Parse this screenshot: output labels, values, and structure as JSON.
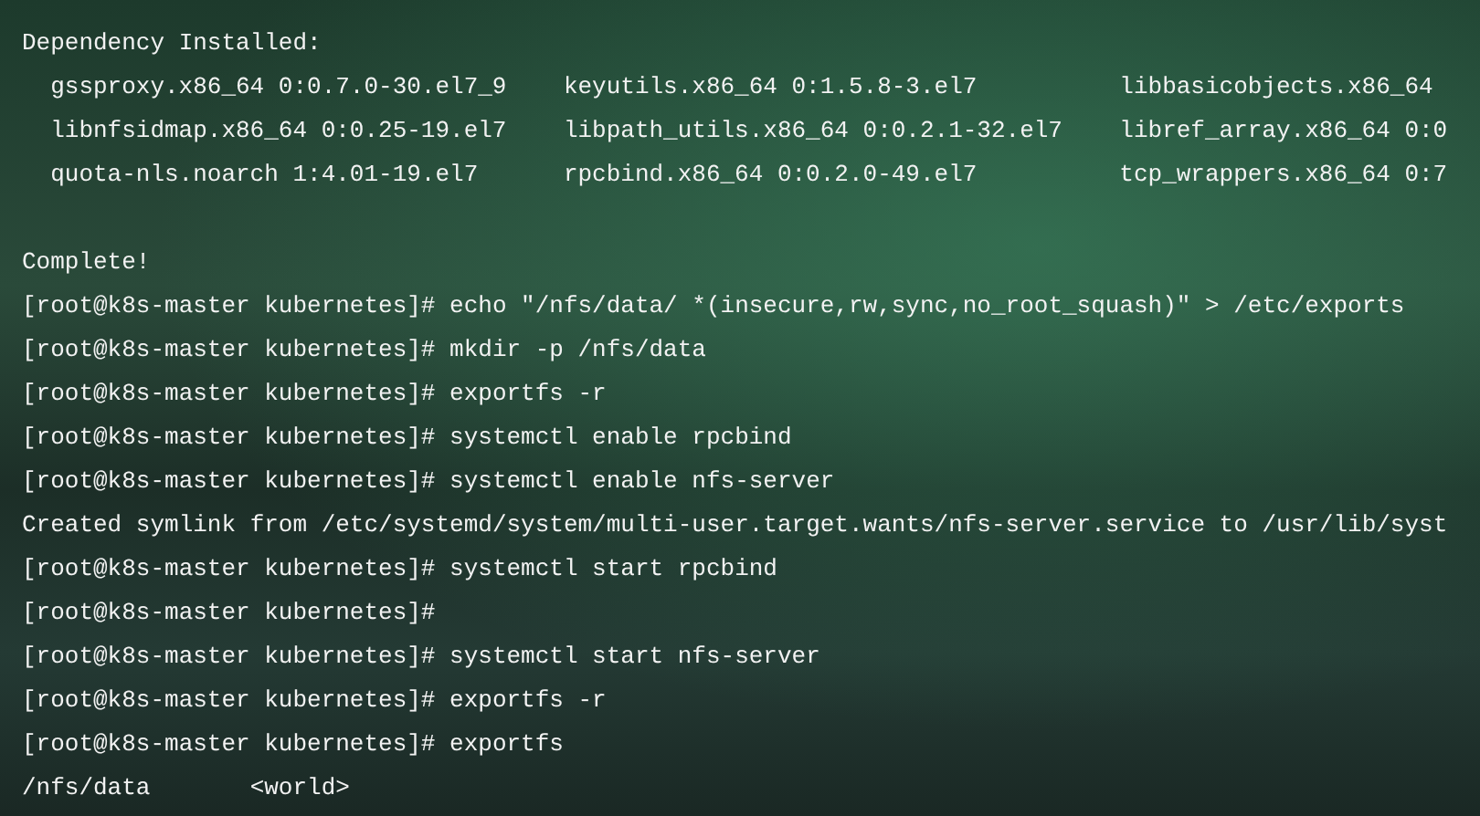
{
  "terminal": {
    "lines": [
      {
        "kind": "text",
        "text": "Dependency Installed:"
      },
      {
        "kind": "columns",
        "cells": [
          "gssproxy.x86_64 0:0.7.0-30.el7_9",
          "keyutils.x86_64 0:1.5.8-3.el7",
          "libbasicobjects.x86_64"
        ]
      },
      {
        "kind": "columns",
        "cells": [
          "libnfsidmap.x86_64 0:0.25-19.el7",
          "libpath_utils.x86_64 0:0.2.1-32.el7",
          "libref_array.x86_64 0:0"
        ]
      },
      {
        "kind": "columns",
        "cells": [
          "quota-nls.noarch 1:4.01-19.el7",
          "rpcbind.x86_64 0:0.2.0-49.el7",
          "tcp_wrappers.x86_64 0:7"
        ]
      },
      {
        "kind": "blank"
      },
      {
        "kind": "text",
        "text": "Complete!"
      },
      {
        "kind": "text",
        "text": "[root@k8s-master kubernetes]# echo \"/nfs/data/ *(insecure,rw,sync,no_root_squash)\" > /etc/exports"
      },
      {
        "kind": "text",
        "text": "[root@k8s-master kubernetes]# mkdir -p /nfs/data"
      },
      {
        "kind": "text",
        "text": "[root@k8s-master kubernetes]# exportfs -r"
      },
      {
        "kind": "text",
        "text": "[root@k8s-master kubernetes]# systemctl enable rpcbind"
      },
      {
        "kind": "text",
        "text": "[root@k8s-master kubernetes]# systemctl enable nfs-server"
      },
      {
        "kind": "text",
        "text": "Created symlink from /etc/systemd/system/multi-user.target.wants/nfs-server.service to /usr/lib/syst"
      },
      {
        "kind": "text",
        "text": "[root@k8s-master kubernetes]# systemctl start rpcbind"
      },
      {
        "kind": "text",
        "text": "[root@k8s-master kubernetes]#"
      },
      {
        "kind": "text",
        "text": "[root@k8s-master kubernetes]# systemctl start nfs-server"
      },
      {
        "kind": "text",
        "text": "[root@k8s-master kubernetes]# exportfs -r"
      },
      {
        "kind": "text",
        "text": "[root@k8s-master kubernetes]# exportfs"
      },
      {
        "kind": "text",
        "text": "/nfs/data       <world>"
      }
    ]
  }
}
